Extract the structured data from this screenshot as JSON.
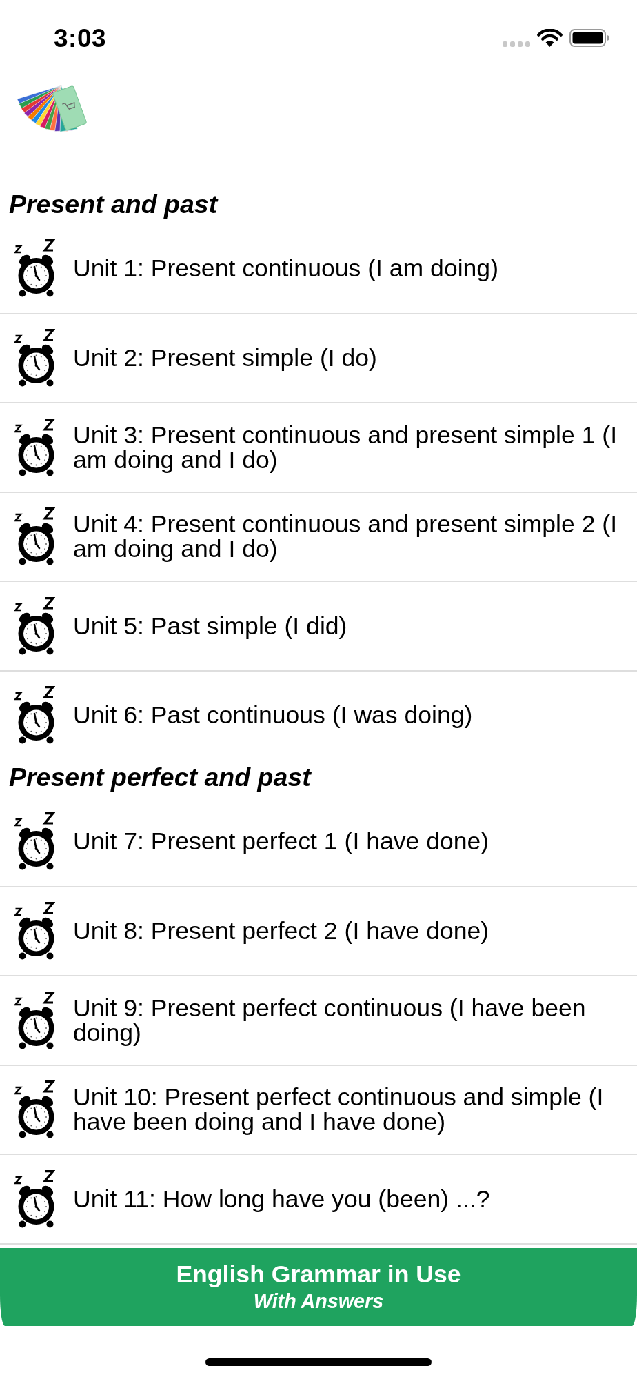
{
  "status_bar": {
    "time": "3:03"
  },
  "sections": [
    {
      "title": "Present and past",
      "units": [
        "Unit 1: Present continuous (I am doing)",
        "Unit 2: Present simple (I do)",
        "Unit 3: Present continuous and present simple 1 (I am doing and I do)",
        "Unit 4: Present continuous and present simple 2 (I am doing and I do)",
        "Unit 5: Past simple (I did)",
        "Unit 6: Past continuous (I was doing)"
      ]
    },
    {
      "title": "Present perfect and past",
      "units": [
        "Unit 7: Present perfect 1 (I have done)",
        "Unit 8: Present perfect 2 (I have done)",
        "Unit 9: Present perfect continuous (I have been doing)",
        "Unit 10: Present perfect continuous and simple (I have been doing and I have done)",
        "Unit 11: How long have you (been) ...?"
      ]
    }
  ],
  "footer": {
    "title": "English Grammar in Use",
    "subtitle": "With Answers"
  }
}
